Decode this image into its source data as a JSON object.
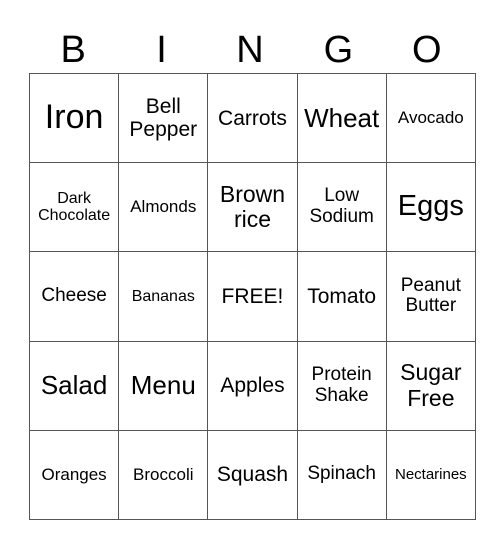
{
  "header": [
    "B",
    "I",
    "N",
    "G",
    "O"
  ],
  "cells": [
    [
      "Iron",
      "Bell\nPepper",
      "Carrots",
      "Wheat",
      "Avocado"
    ],
    [
      "Dark\nChocolate",
      "Almonds",
      "Brown\nrice",
      "Low\nSodium",
      "Eggs"
    ],
    [
      "Cheese",
      "Bananas",
      "FREE!",
      "Tomato",
      "Peanut\nButter"
    ],
    [
      "Salad",
      "Menu",
      "Apples",
      "Protein\nShake",
      "Sugar\nFree"
    ],
    [
      "Oranges",
      "Broccoli",
      "Squash",
      "Spinach",
      "Nectarines"
    ]
  ]
}
